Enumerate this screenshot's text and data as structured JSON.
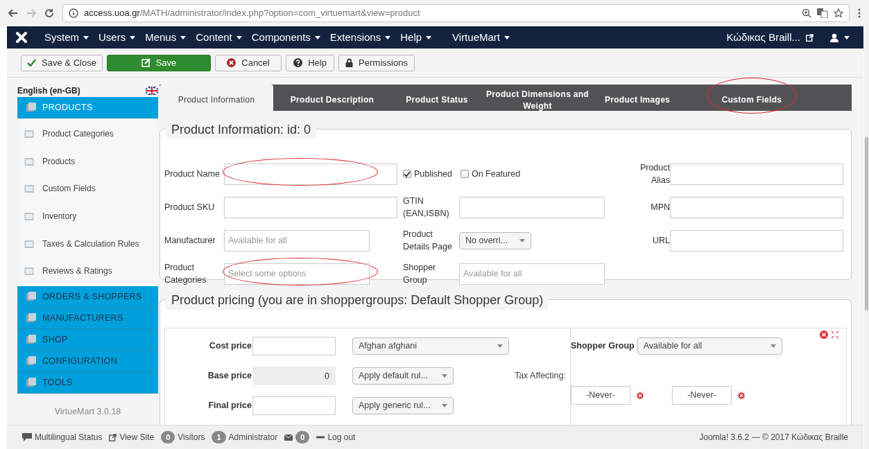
{
  "browser": {
    "url_host": "access.uoa.gr",
    "url_path": "/MATH/administrator/index.php?option=com_virtuemart&view=product"
  },
  "menu": {
    "items": [
      {
        "label": "System"
      },
      {
        "label": "Users"
      },
      {
        "label": "Menus"
      },
      {
        "label": "Content"
      },
      {
        "label": "Components"
      },
      {
        "label": "Extensions"
      },
      {
        "label": "Help"
      },
      {
        "label": "VirtueMart"
      }
    ],
    "site_link": "Κώδικας Braill..."
  },
  "toolbar": [
    {
      "label": "Save & Close",
      "kind": "check"
    },
    {
      "label": "Save",
      "kind": "edit"
    },
    {
      "label": "Cancel",
      "kind": "cancel"
    },
    {
      "label": "Help",
      "kind": "help"
    },
    {
      "label": "Permissions",
      "kind": "lock"
    }
  ],
  "sidebar": {
    "language": "English (en-GB)",
    "groups": [
      {
        "label": "PRODUCTS",
        "expanded": true,
        "children": [
          {
            "label": "Product Categories"
          },
          {
            "label": "Products"
          },
          {
            "label": "Custom Fields"
          },
          {
            "label": "Inventory"
          },
          {
            "label": "Taxes & Calculation Rules"
          },
          {
            "label": "Reviews & Ratings"
          }
        ]
      },
      {
        "label": "ORDERS & SHOPPERS",
        "expanded": false
      },
      {
        "label": "MANUFACTURERS",
        "expanded": false
      },
      {
        "label": "SHOP",
        "expanded": false
      },
      {
        "label": "CONFIGURATION",
        "expanded": false
      },
      {
        "label": "TOOLS",
        "expanded": false
      }
    ],
    "version": "VirtueMart 3.0.18"
  },
  "tabs": [
    {
      "label": "Product Information",
      "selected": true,
      "highlighted": false
    },
    {
      "label": "Product Description",
      "selected": false,
      "highlighted": false
    },
    {
      "label": "Product Status",
      "selected": false,
      "highlighted": false
    },
    {
      "label": "Product Dimensions and Weight",
      "selected": false,
      "highlighted": false
    },
    {
      "label": "Product Images",
      "selected": false,
      "highlighted": false
    },
    {
      "label": "Custom Fields",
      "selected": false,
      "highlighted": true
    }
  ],
  "product_information": {
    "legend": "Product Information: id: 0",
    "rows": [
      [
        {
          "kind": "text",
          "label": "Product Name",
          "highlighted": true
        },
        {
          "kind": "checks",
          "checks": [
            {
              "label": "Published",
              "checked": true
            },
            {
              "label": "On Featured",
              "checked": false
            }
          ]
        },
        {
          "kind": "text",
          "label": "Product Alias"
        }
      ],
      [
        {
          "kind": "text",
          "label": "Product SKU"
        },
        {
          "kind": "text",
          "label": "GTIN (EAN,ISBN)"
        },
        {
          "kind": "text",
          "label": "MPN"
        }
      ],
      [
        {
          "kind": "text",
          "label": "Manufacturer",
          "placeholder": "Available for all"
        },
        {
          "kind": "select",
          "label": "Product Details Page",
          "value": "No overri..."
        },
        {
          "kind": "text",
          "label": "URL"
        }
      ],
      [
        {
          "kind": "text",
          "label": "Product Categories",
          "placeholder": "Select some options",
          "highlighted": true
        },
        {
          "kind": "text",
          "label": "Shopper Group",
          "placeholder": "Available for all"
        }
      ]
    ]
  },
  "product_pricing": {
    "legend": "Product pricing (you are in shoppergroups: Default Shopper Group)",
    "rows": [
      {
        "label": "Cost price",
        "value": "",
        "disabled": false,
        "select": "Afghan afghani",
        "note": ""
      },
      {
        "label": "Base price",
        "value": "0",
        "disabled": true,
        "select": "Apply default rul...",
        "note": "Tax Affecting:"
      },
      {
        "label": "Final price",
        "value": "",
        "disabled": false,
        "select": "Apply generic rul...",
        "note": ""
      }
    ],
    "shopper_group": {
      "label": "Shopper Group",
      "value": "Available for all"
    },
    "dates": [
      "-Never-",
      "-Never-"
    ]
  },
  "status_bar": {
    "left": [
      {
        "kind": "multilingual",
        "label": "Multilingual Status"
      },
      {
        "kind": "view-site",
        "label": "View Site"
      },
      {
        "kind": "count",
        "count": "0",
        "label": "Visitors"
      },
      {
        "kind": "count",
        "count": "1",
        "label": "Administrator"
      },
      {
        "kind": "mail",
        "count": "0"
      },
      {
        "kind": "logout",
        "label": "Log out"
      }
    ],
    "right": "Joomla! 3.6.2 — © 2017 Κώδικας Braille"
  }
}
